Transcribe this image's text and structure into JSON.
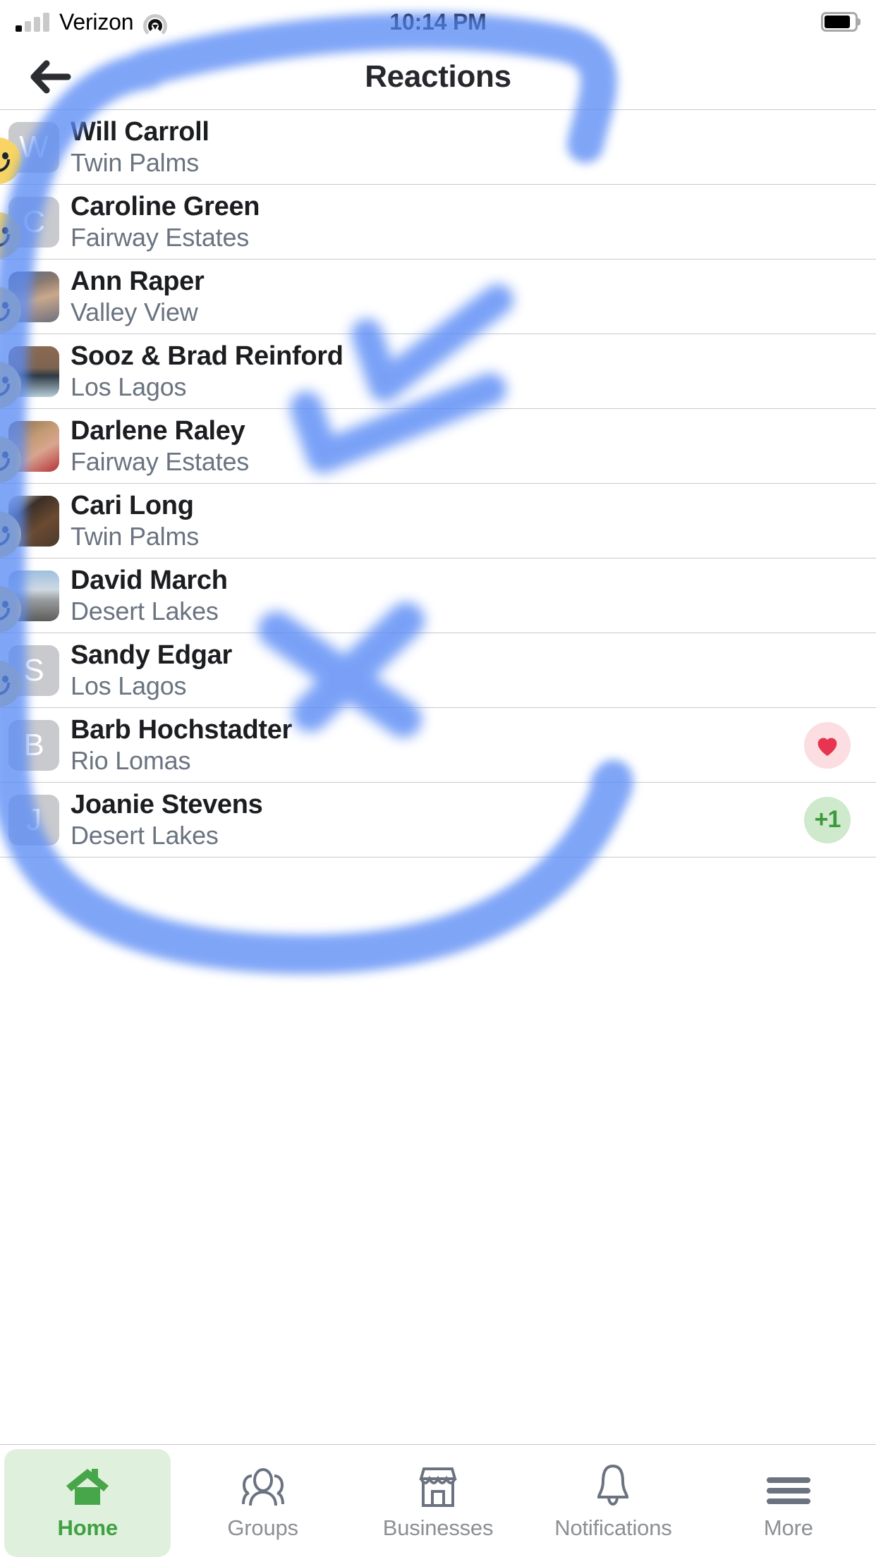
{
  "status_bar": {
    "carrier": "Verizon",
    "time": "10:14 PM",
    "signal_bars_filled": 1,
    "signal_bars_total": 4,
    "wifi_icon": "wifi-icon",
    "battery_icon": "battery-icon",
    "battery_level_percent": 85
  },
  "header": {
    "back_icon": "back-arrow-icon",
    "title": "Reactions"
  },
  "colors": {
    "accent_green": "#3fa142",
    "active_pill": "#dff0dc",
    "emoji_yellow": "#f7d463",
    "heart_red": "#e8344e",
    "heart_bg": "#fbdde2",
    "plus_green": "#3c9a3c",
    "plus_bg": "#cfe9cc",
    "separator": "#c8c9cc",
    "name_text": "#1b1d20",
    "sub_text": "#6a7380",
    "marker_blue": "#5b8cf5"
  },
  "list": {
    "rows": [
      {
        "name": "Will Carroll",
        "neighborhood": "Twin Palms",
        "avatar_type": "letter",
        "avatar_letter": "W",
        "reaction": "smile"
      },
      {
        "name": "Caroline Green",
        "neighborhood": "Fairway Estates",
        "avatar_type": "letter",
        "avatar_letter": "C",
        "reaction": "smile"
      },
      {
        "name": "Ann Raper",
        "neighborhood": "Valley View",
        "avatar_type": "photo",
        "avatar_letter": "",
        "reaction": "smile"
      },
      {
        "name": "Sooz & Brad Reinford",
        "neighborhood": "Los Lagos",
        "avatar_type": "photo",
        "avatar_letter": "",
        "reaction": "smile"
      },
      {
        "name": "Darlene Raley",
        "neighborhood": "Fairway Estates",
        "avatar_type": "photo",
        "avatar_letter": "",
        "reaction": "smile"
      },
      {
        "name": "Cari Long",
        "neighborhood": "Twin Palms",
        "avatar_type": "photo",
        "avatar_letter": "",
        "reaction": "smile"
      },
      {
        "name": "David March",
        "neighborhood": "Desert Lakes",
        "avatar_type": "photo",
        "avatar_letter": "",
        "reaction": "smile"
      },
      {
        "name": "Sandy Edgar",
        "neighborhood": "Los Lagos",
        "avatar_type": "letter",
        "avatar_letter": "S",
        "reaction": "smile"
      },
      {
        "name": "Barb Hochstadter",
        "neighborhood": "Rio Lomas",
        "avatar_type": "letter",
        "avatar_letter": "B",
        "reaction": "heart"
      },
      {
        "name": "Joanie Stevens",
        "neighborhood": "Desert Lakes",
        "avatar_type": "letter",
        "avatar_letter": "J",
        "reaction": "plusone"
      }
    ]
  },
  "tab_bar": {
    "tabs": [
      {
        "label": "Home",
        "icon": "home-icon",
        "active": true
      },
      {
        "label": "Groups",
        "icon": "groups-icon",
        "active": false
      },
      {
        "label": "Businesses",
        "icon": "storefront-icon",
        "active": false
      },
      {
        "label": "Notifications",
        "icon": "bell-icon",
        "active": false
      },
      {
        "label": "More",
        "icon": "hamburger-menu-icon",
        "active": false
      }
    ]
  },
  "annotation": {
    "tool": "blue-marker-highlighter",
    "plus_one_label": "+1"
  }
}
